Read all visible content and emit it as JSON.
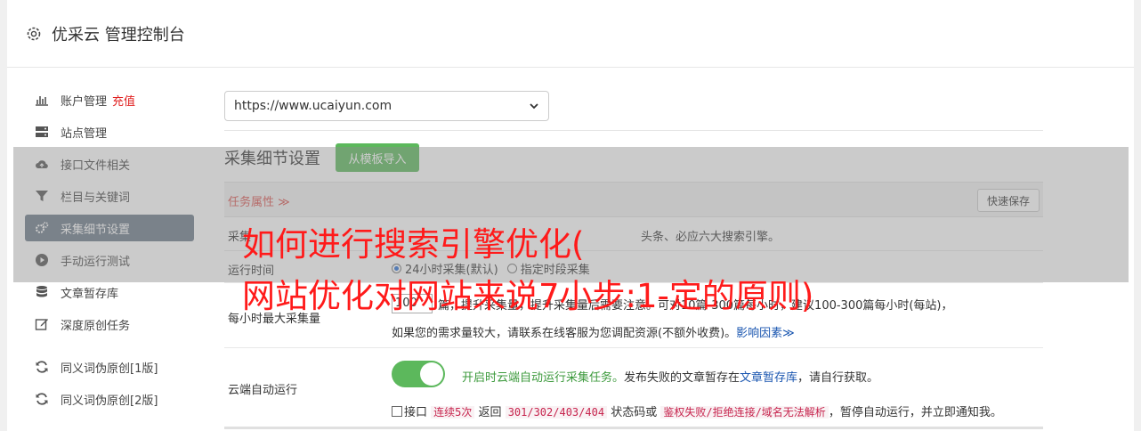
{
  "header": {
    "title": "优采云 管理控制台"
  },
  "sidebar": {
    "items": [
      {
        "label": "账户管理",
        "extra": "充值",
        "icon": "bar-chart-icon"
      },
      {
        "label": "站点管理",
        "icon": "server-icon"
      },
      {
        "label": "接口文件相关",
        "icon": "cloud-upload-icon"
      },
      {
        "label": "栏目与关键词",
        "icon": "filter-icon"
      },
      {
        "label": "采集细节设置",
        "icon": "gears-icon",
        "active": true
      },
      {
        "label": "手动运行测试",
        "icon": "play-circle-icon"
      },
      {
        "label": "文章暂存库",
        "icon": "database-icon"
      },
      {
        "label": "深度原创任务",
        "icon": "edit-icon"
      },
      {
        "label": "同义词伪原创[1版]",
        "icon": "refresh-icon"
      },
      {
        "label": "同义词伪原创[2版]",
        "icon": "refresh-icon"
      }
    ]
  },
  "site_select": {
    "value": "https://www.ucaiyun.com"
  },
  "section": {
    "title": "采集细节设置",
    "template_button": "从模板导入"
  },
  "task": {
    "title": "任务属性 ≫",
    "quick_save": "快速保存"
  },
  "rows": {
    "engines": {
      "label": "采集",
      "text": "头条、必应六大搜索引擎。"
    },
    "run_time": {
      "label": "运行时间",
      "option1": "24小时采集(默认)",
      "option2": "指定时段采集"
    },
    "max": {
      "label": "每小时最大采集量",
      "value": "100",
      "line1": "篇，提升采集量，提升采集量后需要注意。可对10篇-300篇每小时，建议100-300篇每小时(每站)，",
      "line2": "如果您的需求量较大，请联系在线客服为您调配资源(不额外收费)。",
      "link": "影响因素≫"
    },
    "cloud": {
      "label": "云端自动运行",
      "text_green": "开启时云端自动运行采集任务。",
      "text_rest": "发布失败的文章暂存在",
      "link": "文章暂存库",
      "text_end": "，请自行获取。",
      "cb_a": "接口",
      "code1": "连续5次",
      "cb_b": "返回",
      "code2": "301/302/403/404",
      "cb_c": "状态码或",
      "code3": "鉴权失败/拒绝连接/域名无法解析",
      "cb_d": "，暂停自动运行，并立即通知我。"
    }
  },
  "overlay": {
    "line1": "如何进行搜索引擎优化(",
    "line2": "网站优化对网站来说7小步:1-定的原则)"
  }
}
